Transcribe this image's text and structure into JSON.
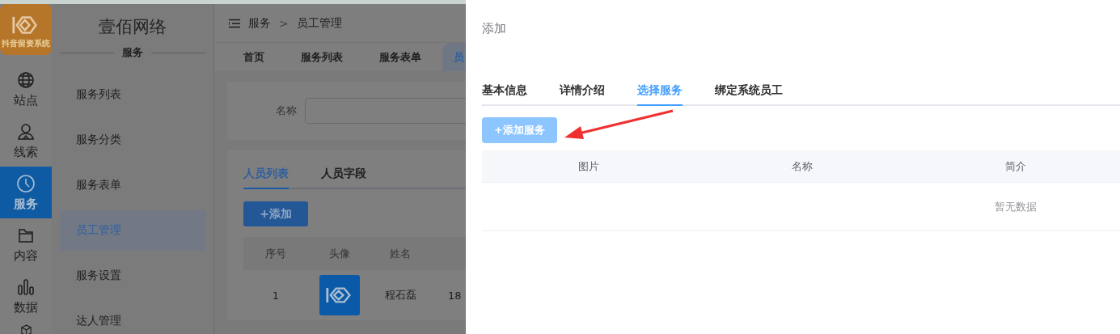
{
  "logo": {
    "caption": "抖音留资系统"
  },
  "rail": [
    {
      "kind": "globe",
      "label": "站点",
      "selected": false
    },
    {
      "kind": "person",
      "label": "线索",
      "selected": false
    },
    {
      "kind": "clock",
      "label": "服务",
      "selected": true
    },
    {
      "kind": "folder",
      "label": "内容",
      "selected": false
    },
    {
      "kind": "bars",
      "label": "数据",
      "selected": false
    },
    {
      "kind": "cube",
      "selected": false
    }
  ],
  "sidebar": {
    "title": "壹佰网络",
    "section": "服务",
    "items": [
      {
        "label": "服务列表",
        "selected": false
      },
      {
        "label": "服务分类",
        "selected": false
      },
      {
        "label": "服务表单",
        "selected": false
      },
      {
        "label": "员工管理",
        "selected": true
      },
      {
        "label": "服务设置",
        "selected": false
      },
      {
        "label": "达人管理",
        "selected": false
      }
    ]
  },
  "main": {
    "breadcrumb": [
      "服务",
      "员工管理"
    ],
    "separator": ">",
    "tabs": [
      {
        "label": "首页",
        "selected": false
      },
      {
        "label": "服务列表",
        "selected": false
      },
      {
        "label": "服务表单",
        "selected": false
      },
      {
        "label": "员",
        "selected": true
      }
    ],
    "filter": {
      "label": "名称"
    },
    "subtabs": [
      {
        "label": "人员列表",
        "selected": true
      },
      {
        "label": "人员字段",
        "selected": false
      }
    ],
    "add_button": "+添加",
    "table": {
      "columns": [
        "序号",
        "头像",
        "姓名"
      ],
      "rows": [
        {
          "index": "1",
          "name": "程石磊",
          "column_4": "18"
        }
      ]
    }
  },
  "drawer": {
    "title": "添加",
    "tabs": [
      {
        "label": "基本信息",
        "selected": false
      },
      {
        "label": "详情介绍",
        "selected": false
      },
      {
        "label": "选择服务",
        "selected": true
      },
      {
        "label": "绑定系统员工",
        "selected": false
      }
    ],
    "add_button": "+添加服务",
    "table": {
      "columns": [
        "图片",
        "名称",
        "简介"
      ],
      "empty_text": "暂无数据"
    }
  }
}
